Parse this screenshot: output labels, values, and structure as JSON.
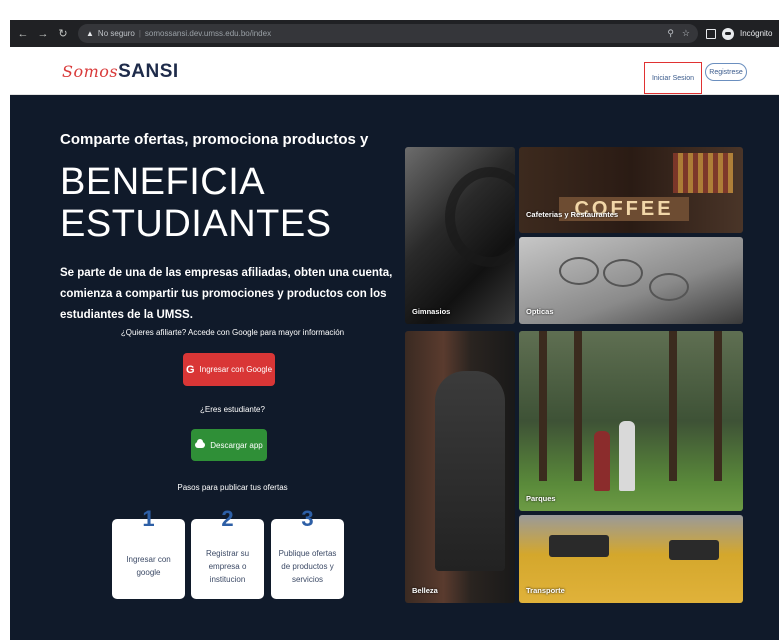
{
  "browser": {
    "not_secure": "No seguro",
    "url": "somossansi.dev.umss.edu.bo/index",
    "profile_label": "Incógnito"
  },
  "header": {
    "logo_script": "Somos",
    "logo_brand": "SANSI",
    "login_label": "Iniciar Sesion",
    "register_label": "Registrese"
  },
  "hero": {
    "subhead": "Comparte ofertas, promociona productos y",
    "title_line1": "BENEFICIA",
    "title_line2": "ESTUDIANTES",
    "description": "Se parte de una de las empresas afiliadas, obten una cuenta, comienza a compartir tus promociones y productos con los estudiantes de la UMSS.",
    "affiliate_question": "¿Quieres afiliarte? Accede con Google para mayor información",
    "google_button": "Ingresar con Google",
    "google_icon": "G",
    "student_question": "¿Eres estudiante?",
    "download_button": "Descargar app",
    "steps_title": "Pasos para publicar tus ofertas",
    "steps": [
      {
        "number": "1",
        "text": "Ingresar con google"
      },
      {
        "number": "2",
        "text": "Registrar su empresa o institucion"
      },
      {
        "number": "3",
        "text": "Publique ofertas de productos y servicios"
      }
    ]
  },
  "categories": {
    "gym": "Gimnasios",
    "cafe": "Cafeterias y Restaurantes",
    "cafe_sign": "COFFEE",
    "optics": "Opticas",
    "beauty": "Belleza",
    "parks": "Parques",
    "transport": "Transporte"
  },
  "colors": {
    "hero_bg": "#101a2a",
    "google_red": "#d93636",
    "download_green": "#2f8f37",
    "brand_navy": "#1e2b4a",
    "brand_red": "#d93a3a",
    "login_highlight": "#e03232"
  }
}
